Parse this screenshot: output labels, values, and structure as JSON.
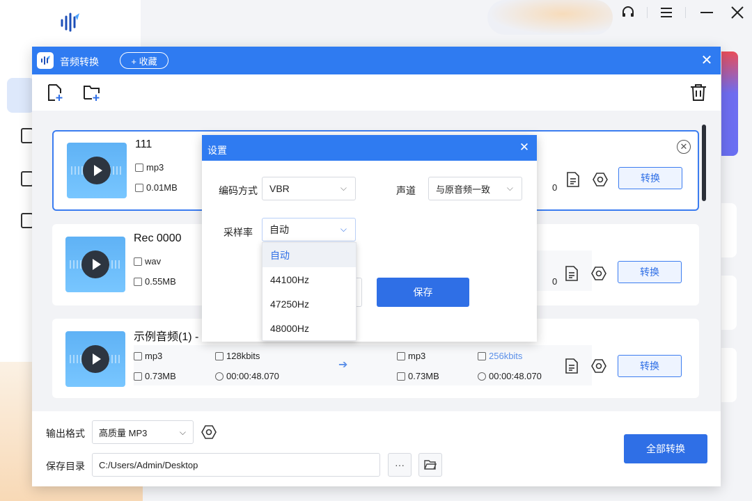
{
  "window": {
    "title": "音频转换",
    "favorite_label": "+ 收藏",
    "close_glyph": "✕"
  },
  "files": [
    {
      "name": "111",
      "src_format": "mp3",
      "src_size": "0.01MB",
      "dst_size_partial": "0",
      "convert_label": "转换"
    },
    {
      "name": "Rec 0000",
      "src_format": "wav",
      "src_size": "0.55MB",
      "dst_size_partial": "0",
      "convert_label": "转换"
    },
    {
      "name": "示例音频(1) -",
      "src_format": "mp3",
      "src_size": "0.73MB",
      "src_bitrate": "128kbits",
      "src_duration": "00:00:48.070",
      "dst_format": "mp3",
      "dst_size": "0.73MB",
      "dst_bitrate": "256kbits",
      "dst_duration": "00:00:48.070",
      "convert_label": "转换"
    }
  ],
  "bottom": {
    "output_format_label": "输出格式",
    "output_format_value": "高质量 MP3",
    "save_dir_label": "保存目录",
    "save_dir_value": "C:/Users/Admin/Desktop",
    "more_label": "···",
    "convert_all_label": "全部转换"
  },
  "settings_dialog": {
    "title": "设置",
    "close_glyph": "✕",
    "encoding_label": "编码方式",
    "encoding_value": "VBR",
    "channel_label": "声道",
    "channel_value": "与原音频一致",
    "sample_rate_label": "采样率",
    "sample_rate_value": "自动",
    "sample_rate_options": [
      "自动",
      "44100Hz",
      "47250Hz",
      "48000Hz"
    ],
    "save_label": "保存"
  },
  "colors": {
    "accent": "#2f7bf1",
    "button": "#2f6fe6",
    "bitrate_highlight": "#5b8fe8"
  }
}
